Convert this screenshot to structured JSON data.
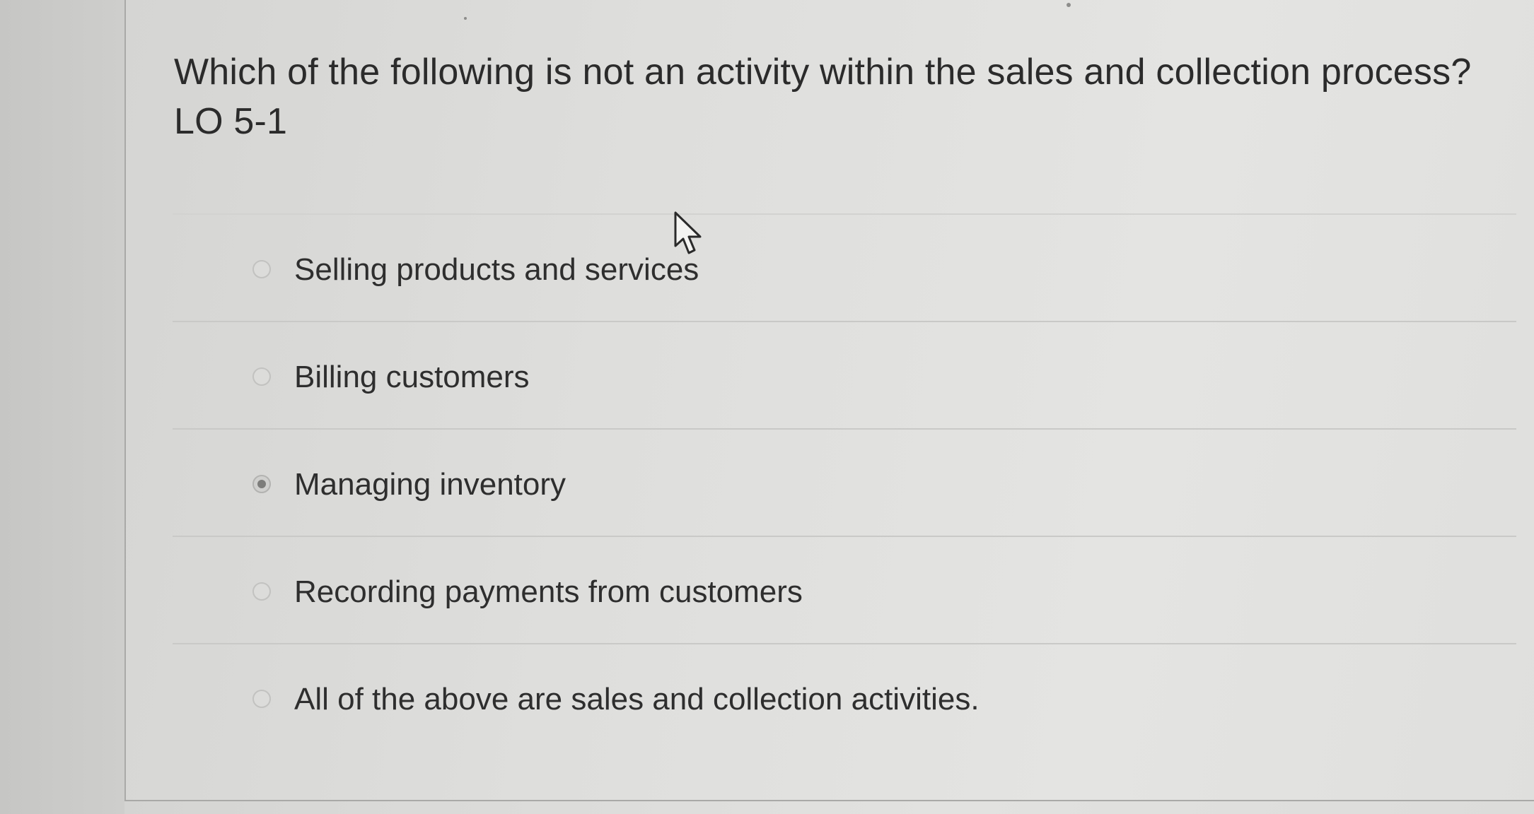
{
  "question": {
    "prompt": "Which of the following is not an activity within the sales and collection process?",
    "learning_objective": "LO 5-1"
  },
  "answers": [
    {
      "label": "Selling products and services",
      "selected": false
    },
    {
      "label": "Billing customers",
      "selected": false
    },
    {
      "label": "Managing inventory",
      "selected": true
    },
    {
      "label": "Recording payments from customers",
      "selected": false
    },
    {
      "label": "All of the above are sales and collection activities.",
      "selected": false
    }
  ],
  "colors": {
    "text": "#2b2b2b",
    "divider": "#c9c9c7",
    "selected_dot": "#7d7d7b"
  },
  "icons": {
    "cursor": "mouse-pointer-icon"
  }
}
